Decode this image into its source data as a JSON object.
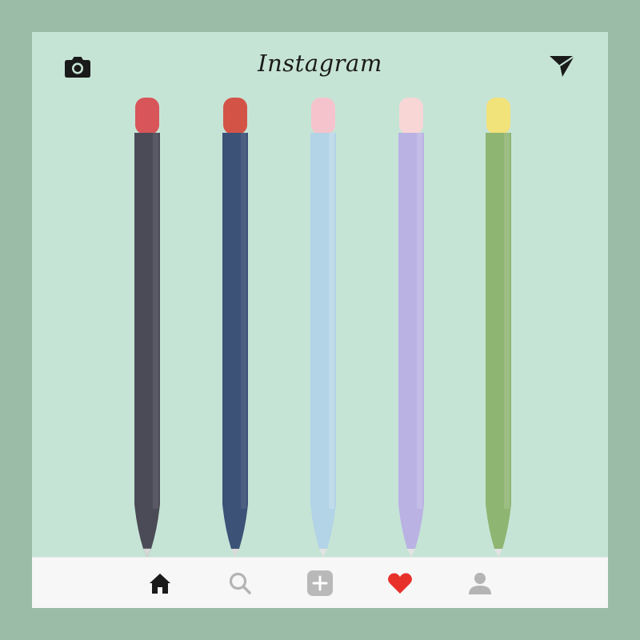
{
  "header": {
    "title": "Instagram",
    "left_icon": "camera-icon",
    "right_icon": "send-icon"
  },
  "post": {
    "pencils": [
      {
        "name": "dark-gray-pencil",
        "body": "#4a4b57",
        "cap": "#d8555a"
      },
      {
        "name": "navy-blue-pencil",
        "body": "#3d5277",
        "cap": "#d35447"
      },
      {
        "name": "light-blue-pencil",
        "body": "#b3d3e6",
        "cap": "#f5c3cb"
      },
      {
        "name": "lavender-pencil",
        "body": "#b9b2e3",
        "cap": "#f8d6d6"
      },
      {
        "name": "sage-green-pencil",
        "body": "#8fb572",
        "cap": "#f2e27a"
      }
    ]
  },
  "bottom_nav": {
    "items": [
      "home-icon",
      "search-icon",
      "add-post-icon",
      "activity-heart-icon",
      "profile-icon"
    ],
    "accent_color": "#e8302b"
  }
}
